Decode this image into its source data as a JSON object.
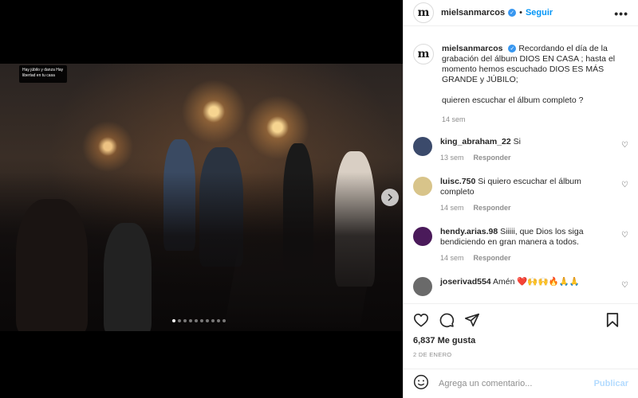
{
  "post": {
    "username": "mielsanmarcos",
    "follow_label": "Seguir",
    "separator": "•",
    "more_label": "•••",
    "avatar_letter": "m",
    "screen_sign_text": "Hay júbilo y danza Hay libertad en tu casa",
    "caption_line1": "Recordando el día de la grabación del álbum DIOS EN CASA ; hasta el momento hemos escuchado DIOS ES MÁS GRANDE y JÚBILO;",
    "caption_line2": "quieren escuchar el álbum completo ?",
    "caption_time": "14 sem",
    "carousel": {
      "count": 10,
      "active": 0
    }
  },
  "comments": [
    {
      "username": "king_abraham_22",
      "text": "Si",
      "time": "13 sem",
      "reply": "Responder",
      "avatar_color": "#3b4a6b"
    },
    {
      "username": "luisc.750",
      "text": "Si quiero escuchar el álbum completo",
      "time": "14 sem",
      "reply": "Responder",
      "avatar_color": "#d8c48a"
    },
    {
      "username": "hendy.arias.98",
      "text": "Siiiii, que Dios los siga bendiciendo en gran manera a todos.",
      "time": "14 sem",
      "reply": "Responder",
      "avatar_color": "#4a1a5a"
    },
    {
      "username": "joserivad554",
      "text": "Amén ❤️🙌🙌🔥🙏🙏",
      "time": "",
      "reply": "",
      "avatar_color": "#6a6a6a"
    }
  ],
  "actions": {
    "likes": "6,837 Me gusta",
    "date": "2 DE ENERO",
    "comment_placeholder": "Agrega un comentario...",
    "publish_label": "Publicar"
  },
  "colors": {
    "accent": "#0095f6",
    "verified": "#3897f0",
    "publish_disabled": "#b3dbff"
  }
}
